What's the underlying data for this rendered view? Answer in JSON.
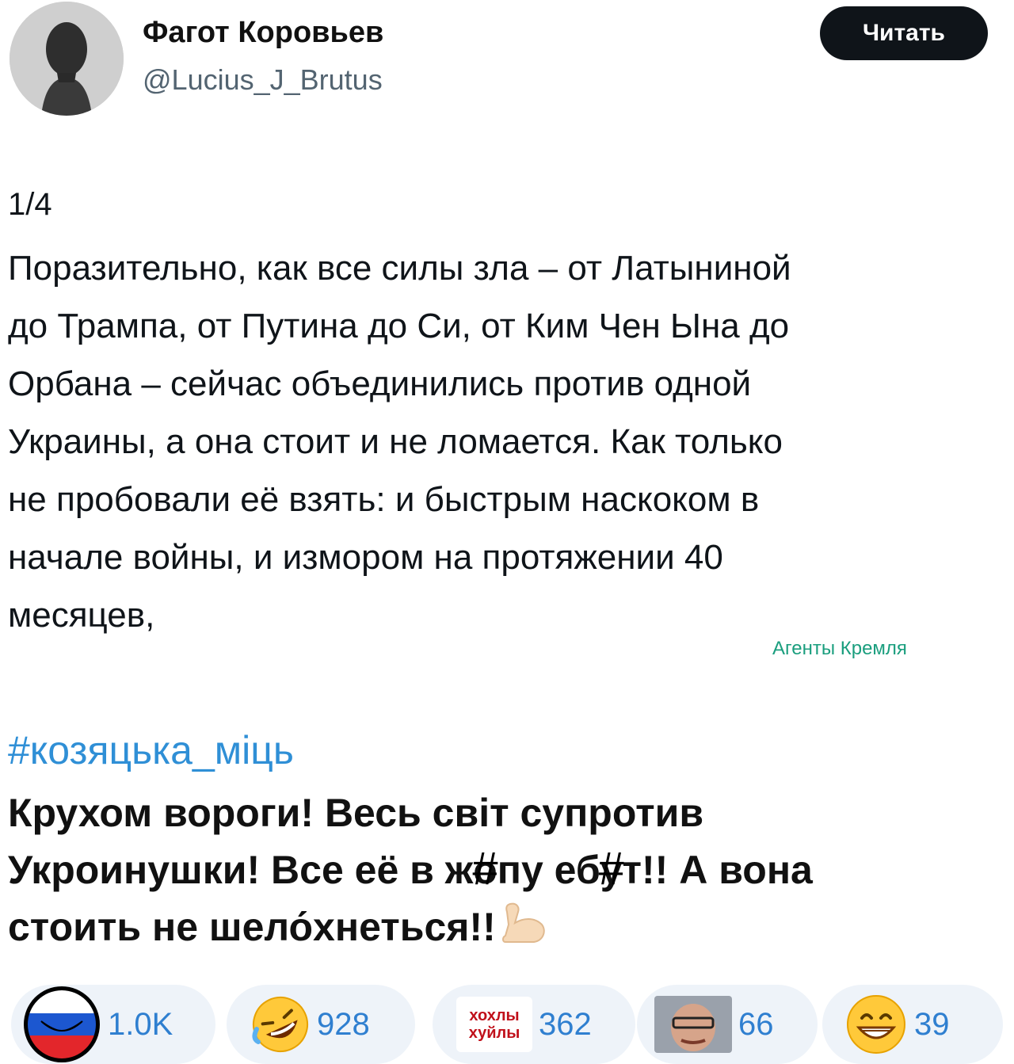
{
  "author": {
    "display_name": "Фагот Коровьев",
    "handle": "@Lucius_J_Brutus",
    "avatar_icon": "bust-portrait-avatar"
  },
  "follow_button": {
    "label": "Читать"
  },
  "tweet": {
    "counter": "1/4",
    "text": "Поразительно, как все силы зла – от Латыниной\nдо Трампа, от Путина до Си, от Ким Чен Ына до\nОрбана – сейчас объединились против одной\nУкраины, а она стоит и не ломается. Как только\nне пробовали её взять: и быстрым наскоком в\nначале войны, и измором на протяжении 40\nмесяцев,"
  },
  "watermark": "Агенты Кремля",
  "reply": {
    "hashtag": "#козяцька_міць",
    "line1": "Крухом вороги! Весь світ супротив",
    "line2_a": "Укроинушки! Все её в ж",
    "line2_censor1": "о",
    "line2_b": "пу еб",
    "line2_censor2": "у",
    "line2_c": "т!! А вона",
    "line3": "стоить не шело́хнеться!!",
    "censor_mark": "#"
  },
  "reactions": [
    {
      "icon": "trollface-russian-flag-icon",
      "count": "1.0K"
    },
    {
      "icon": "rofl-emoji-icon",
      "count": "928"
    },
    {
      "icon": "text-sticker-icon",
      "count": "362",
      "sticker_line1": "хохлы",
      "sticker_line2": "хуйлы"
    },
    {
      "icon": "face-photo-icon",
      "count": "66"
    },
    {
      "icon": "grinning-emoji-icon",
      "count": "39"
    }
  ],
  "colors": {
    "link": "#2f8fd6",
    "reaction_count": "#2f7fd0",
    "reaction_bg": "#eef3f9",
    "watermark": "#1a9e7e",
    "follow_bg": "#0f1419"
  }
}
